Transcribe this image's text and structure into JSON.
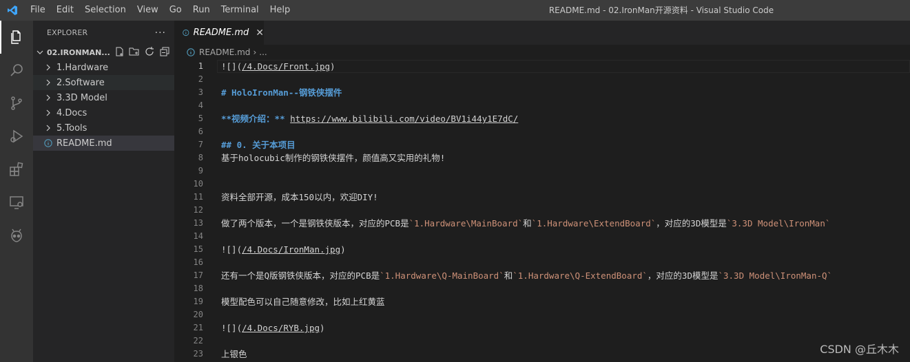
{
  "menu": [
    "File",
    "Edit",
    "Selection",
    "View",
    "Go",
    "Run",
    "Terminal",
    "Help"
  ],
  "window_title": "README.md - 02.IronMan开源资料 - Visual Studio Code",
  "sidebar": {
    "title": "EXPLORER",
    "more": "···",
    "folder": "02.IRONMAN...",
    "items": [
      {
        "label": "1.Hardware"
      },
      {
        "label": "2.Software"
      },
      {
        "label": "3.3D Model"
      },
      {
        "label": "4.Docs"
      },
      {
        "label": "5.Tools"
      },
      {
        "label": "README.md"
      }
    ]
  },
  "tab": {
    "label": "README.md",
    "close": "✕"
  },
  "breadcrumb": {
    "file": "README.md",
    "sep": "›",
    "more": "..."
  },
  "lines": [
    {
      "n": "1",
      "parts": [
        {
          "t": "![](",
          "c": ""
        },
        {
          "t": "/4.Docs/Front.jpg",
          "c": "url"
        },
        {
          "t": ")",
          "c": ""
        }
      ]
    },
    {
      "n": "2",
      "parts": []
    },
    {
      "n": "3",
      "parts": [
        {
          "t": "# HoloIronMan--钢铁侠摆件",
          "c": "heading"
        }
      ]
    },
    {
      "n": "4",
      "parts": []
    },
    {
      "n": "5",
      "parts": [
        {
          "t": "**视频介绍：**",
          "c": "heading"
        },
        {
          "t": " ",
          "c": ""
        },
        {
          "t": "https://www.bilibili.com/video/BV1i44y1E7dC/",
          "c": "url"
        }
      ]
    },
    {
      "n": "6",
      "parts": []
    },
    {
      "n": "7",
      "parts": [
        {
          "t": "## 0. 关于本项目",
          "c": "heading"
        }
      ]
    },
    {
      "n": "8",
      "parts": [
        {
          "t": "基于holocubic制作的钢铁侠摆件，颜值高又实用的礼物!",
          "c": ""
        }
      ]
    },
    {
      "n": "9",
      "parts": []
    },
    {
      "n": "10",
      "parts": []
    },
    {
      "n": "11",
      "parts": [
        {
          "t": "资料全部开源，成本150以内，欢迎DIY!",
          "c": ""
        }
      ]
    },
    {
      "n": "12",
      "parts": []
    },
    {
      "n": "13",
      "parts": [
        {
          "t": "做了两个版本，一个是钢铁侠版本，对应的PCB是",
          "c": ""
        },
        {
          "t": "`1.Hardware\\MainBoard`",
          "c": "code-span"
        },
        {
          "t": "和",
          "c": ""
        },
        {
          "t": "`1.Hardware\\ExtendBoard`",
          "c": "code-span"
        },
        {
          "t": "，对应的3D模型是",
          "c": ""
        },
        {
          "t": "`3.3D Model\\IronMan`",
          "c": "code-span"
        }
      ]
    },
    {
      "n": "14",
      "parts": []
    },
    {
      "n": "15",
      "parts": [
        {
          "t": "![](",
          "c": ""
        },
        {
          "t": "/4.Docs/IronMan.jpg",
          "c": "url"
        },
        {
          "t": ")",
          "c": ""
        }
      ]
    },
    {
      "n": "16",
      "parts": []
    },
    {
      "n": "17",
      "parts": [
        {
          "t": "还有一个是Q版钢铁侠版本，对应的PCB是",
          "c": ""
        },
        {
          "t": "`1.Hardware\\Q-MainBoard`",
          "c": "code-span"
        },
        {
          "t": "和",
          "c": ""
        },
        {
          "t": "`1.Hardware\\Q-ExtendBoard`",
          "c": "code-span"
        },
        {
          "t": "，对应的3D模型是",
          "c": ""
        },
        {
          "t": "`3.3D Model\\IronMan-Q`",
          "c": "code-span"
        }
      ]
    },
    {
      "n": "18",
      "parts": []
    },
    {
      "n": "19",
      "parts": [
        {
          "t": "模型配色可以自己随意修改，比如上红黄蓝",
          "c": ""
        }
      ]
    },
    {
      "n": "20",
      "parts": []
    },
    {
      "n": "21",
      "parts": [
        {
          "t": "![](",
          "c": ""
        },
        {
          "t": "/4.Docs/RYB.jpg",
          "c": "url"
        },
        {
          "t": ")",
          "c": ""
        }
      ]
    },
    {
      "n": "22",
      "parts": []
    },
    {
      "n": "23",
      "parts": [
        {
          "t": "上银色",
          "c": ""
        }
      ]
    }
  ],
  "watermark": "CSDN @丘木木",
  "colors": {
    "accent": "#007acc",
    "heading": "#569cd6",
    "code": "#ce9178"
  }
}
